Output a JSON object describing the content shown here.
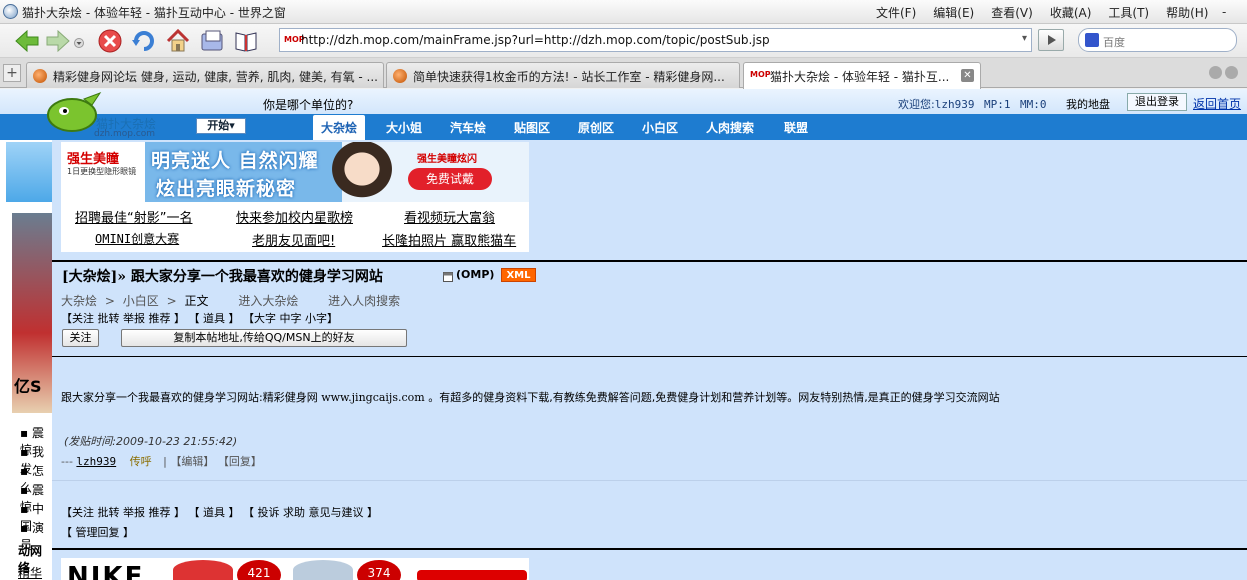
{
  "window": {
    "title": "猫扑大杂烩 - 体验年轻 - 猫扑互动中心 - 世界之窗",
    "menu": [
      "文件(F)",
      "编辑(E)",
      "查看(V)",
      "收藏(A)",
      "工具(T)",
      "帮助(H)"
    ],
    "min_label": "-"
  },
  "toolbar": {
    "url": "http://dzh.mop.com/mainFrame.jsp?url=http://dzh.mop.com/topic/postSub.jsp",
    "url_favicon": "MOP",
    "search_placeholder": "百度"
  },
  "tabs": [
    {
      "label": "精彩健身网论坛 健身, 运动, 健康, 营养, 肌肉, 健美, 有氧 - ...",
      "icon": "site-icon",
      "active": false
    },
    {
      "label": "简单快速获得1枚金币的方法! - 站长工作室 - 精彩健身网...",
      "icon": "site-icon",
      "active": false
    },
    {
      "label": "猫扑大杂烩 - 体验年轻 - 猫扑互...",
      "icon": "mop-icon",
      "active": true
    }
  ],
  "site": {
    "logo_text": "猫扑大杂烩",
    "logo_url": "dzh.mop.com",
    "which_unit": "你是哪个单位的?",
    "welcome_prefix": "欢迎您:",
    "username": "lzh939",
    "mp": "MP:1",
    "mm": "MM:0",
    "my_land": "我的地盘",
    "logout": "退出登录",
    "back_home": "返回首页",
    "start": "开始▾",
    "nav": [
      "大杂烩",
      "大小姐",
      "汽车烩",
      "贴图区",
      "原创区",
      "小白区",
      "人肉搜索",
      "联盟"
    ]
  },
  "sidebar": {
    "lines": [
      "▪ 震惊",
      "▪ 我发",
      "▪ 怎么",
      "▪ 震惊",
      "▪ 中国",
      "▪ 演员"
    ],
    "bold_label": "动网络",
    "bottom_label": "精华",
    "img_text": "亿S"
  },
  "ad_banner": {
    "brand": "强生美瞳",
    "brand_sub": "1日更换型隐形眼镜",
    "slogan1": "明亮迷人 自然闪耀",
    "slogan2": "炫出亮眼新秘密",
    "corner_brand": "强生美瞳炫闪",
    "button": "免费试戴"
  },
  "ad_links": [
    [
      "招聘最佳“射影”一名",
      "快来参加校内星歌榜",
      "看视频玩大富翁"
    ],
    [
      "OMINI创意大赛",
      "老朋友见面吧!",
      "长隆拍照片 赢取熊猫车"
    ]
  ],
  "post": {
    "title": "[大杂烩]» 跟大家分享一个我最喜欢的健身学习网站",
    "author_tag": "(OMP)",
    "xml_badge": "XML",
    "breadcrumb": [
      "大杂烩",
      ">",
      "小白区",
      ">",
      "正文"
    ],
    "crumb_links": [
      "进入大杂烩",
      "进入人肉搜索"
    ],
    "tools_line": "【关注 批转 举报 推荐 】 【 道具 】 【大字 中字 小字】",
    "follow_btn": "关注",
    "copy_btn": "复制本帖地址,传给QQ/MSN上的好友",
    "body_before": "跟大家分享一个我最喜欢的健身学习网站:精彩健身网 ",
    "body_url": "www.jingcaijs.com",
    "body_after": " 。有超多的健身资料下载,有教练免费解答问题,免费健身计划和营养计划等。网友特别热情,是真正的健身学习交流网站",
    "post_time": "(发贴时间:2009-10-23 21:55:42)",
    "byline_prefix": "--- ",
    "author": "lzh939",
    "chuanhu": "传呼",
    "byline_sep": "|",
    "edit": "【编辑】",
    "reply": "【回复】",
    "footer_tools1": "【关注 批转 举报 推荐 】 【 道具 】 【 投诉 求助 意见与建议 】",
    "footer_tools2": "【 管理回复 】"
  },
  "ad2": {
    "brand": "NIKE",
    "badge1": "421",
    "badge2": "374"
  }
}
